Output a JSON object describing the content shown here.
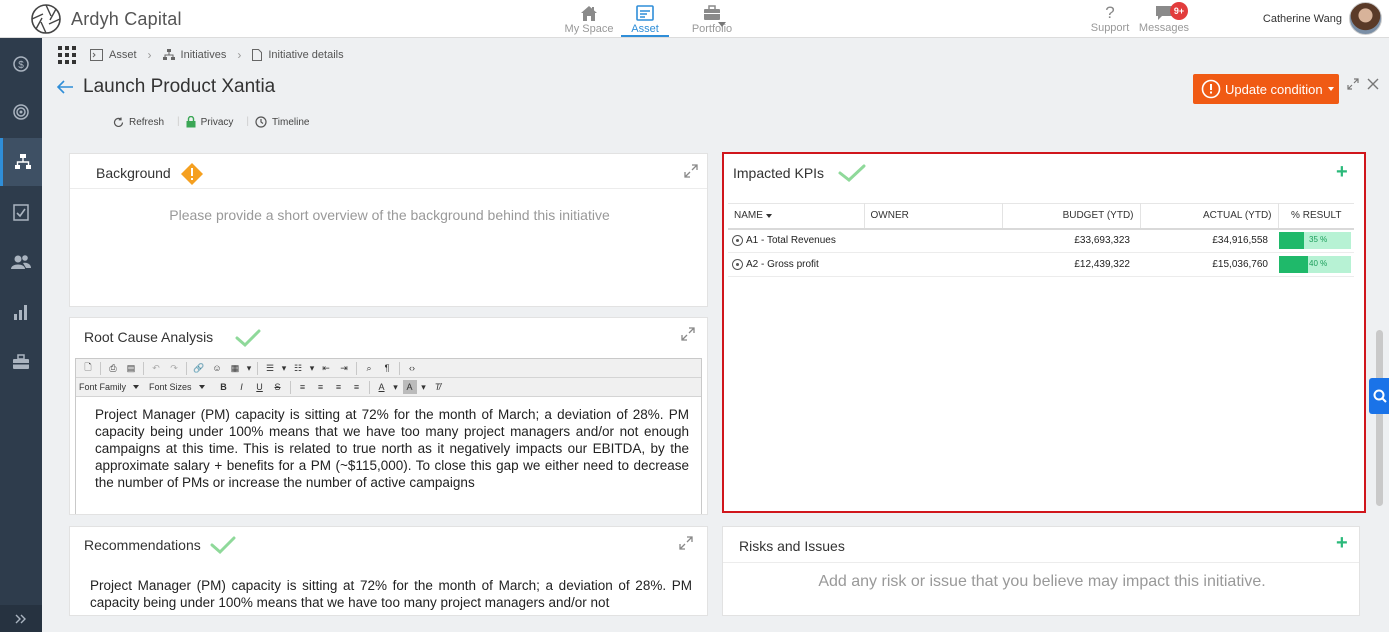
{
  "app": {
    "name": "Ardyh Capital",
    "user_name": "Catherine Wang"
  },
  "topnav": {
    "items": [
      {
        "label": "My Space",
        "icon": "home-icon"
      },
      {
        "label": "Asset",
        "icon": "asset-icon",
        "active": true
      },
      {
        "label": "Portfolio",
        "icon": "briefcase-icon"
      }
    ],
    "support_label": "Support",
    "messages_label": "Messages",
    "messages_badge": "9+"
  },
  "sidebar": {
    "items": [
      {
        "icon": "money-icon"
      },
      {
        "icon": "target-icon"
      },
      {
        "icon": "hierarchy-icon",
        "active": true
      },
      {
        "icon": "checklist-icon"
      },
      {
        "icon": "people-icon"
      },
      {
        "icon": "bar-chart-icon"
      },
      {
        "icon": "toolbox-icon"
      }
    ],
    "collapse_icon": "double-chevron-right-icon"
  },
  "breadcrumb": {
    "items": [
      "Asset",
      "Initiatives",
      "Initiative details"
    ]
  },
  "page": {
    "title": "Launch Product Xantia",
    "update_button": "Update condition",
    "actions": [
      "Refresh",
      "Privacy",
      "Timeline"
    ]
  },
  "background_panel": {
    "title": "Background",
    "placeholder": "Please provide a short overview of the background behind this initiative"
  },
  "root_cause_panel": {
    "title": "Root Cause Analysis",
    "toolbar": {
      "font_family": "Font Family",
      "font_sizes": "Font Sizes"
    },
    "text": "Project Manager (PM) capacity is sitting at 72% for the month of March; a deviation of 28%. PM capacity being under 100% means that we have too many project managers and/or not enough campaigns at this time. This is related to true north as it negatively impacts our EBITDA, by the approximate salary + benefits for a PM (~$115,000). To close this gap we either need to decrease the number of PMs or increase the number of active campaigns"
  },
  "recommendations_panel": {
    "title": "Recommendations",
    "text": "Project Manager (PM) capacity is sitting at 72% for the month of March; a deviation of 28%. PM capacity being under 100% means that we have too many project managers and/or not"
  },
  "kpi_panel": {
    "title": "Impacted KPIs",
    "columns": [
      "NAME",
      "OWNER",
      "BUDGET (YTD)",
      "ACTUAL (YTD)",
      "% RESULT"
    ],
    "rows": [
      {
        "name": "A1 - Total Revenues",
        "owner": "",
        "budget": "£33,693,323",
        "actual": "£34,916,558",
        "result_label": "35 %",
        "result_fraction": 0.35
      },
      {
        "name": "A2 - Gross profit",
        "owner": "",
        "budget": "£12,439,322",
        "actual": "£15,036,760",
        "result_label": "40 %",
        "result_fraction": 0.4
      }
    ]
  },
  "risks_panel": {
    "title": "Risks and Issues",
    "placeholder": "Add any risk or issue that you believe may impact this initiative."
  },
  "colors": {
    "accent": "#2f8ed8",
    "update_button": "#f05a14",
    "check": "#8fd99a",
    "warning": "#f5a020",
    "result_bar": "#1fb96a",
    "highlight_border": "#d0161c"
  }
}
